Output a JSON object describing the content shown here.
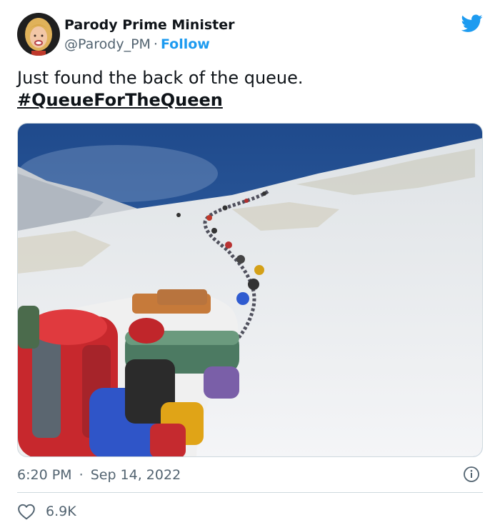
{
  "author": {
    "display_name": "Parody Prime Minister",
    "handle": "@Parody_PM",
    "separator": "·",
    "follow_label": "Follow"
  },
  "tweet": {
    "text": "Just found the back of the queue.",
    "hashtag": "#QueueForTheQueen"
  },
  "meta": {
    "time": "6:20 PM",
    "separator": "·",
    "date": "Sep 14, 2022"
  },
  "engagement": {
    "likes": "6.9K"
  },
  "icons": {
    "brand": "twitter-bird-icon",
    "info": "info-icon",
    "like": "heart-icon"
  },
  "colors": {
    "brand_blue": "#1d9bf0",
    "text_primary": "#0f1419",
    "text_secondary": "#536471",
    "border": "#cfd9de"
  }
}
